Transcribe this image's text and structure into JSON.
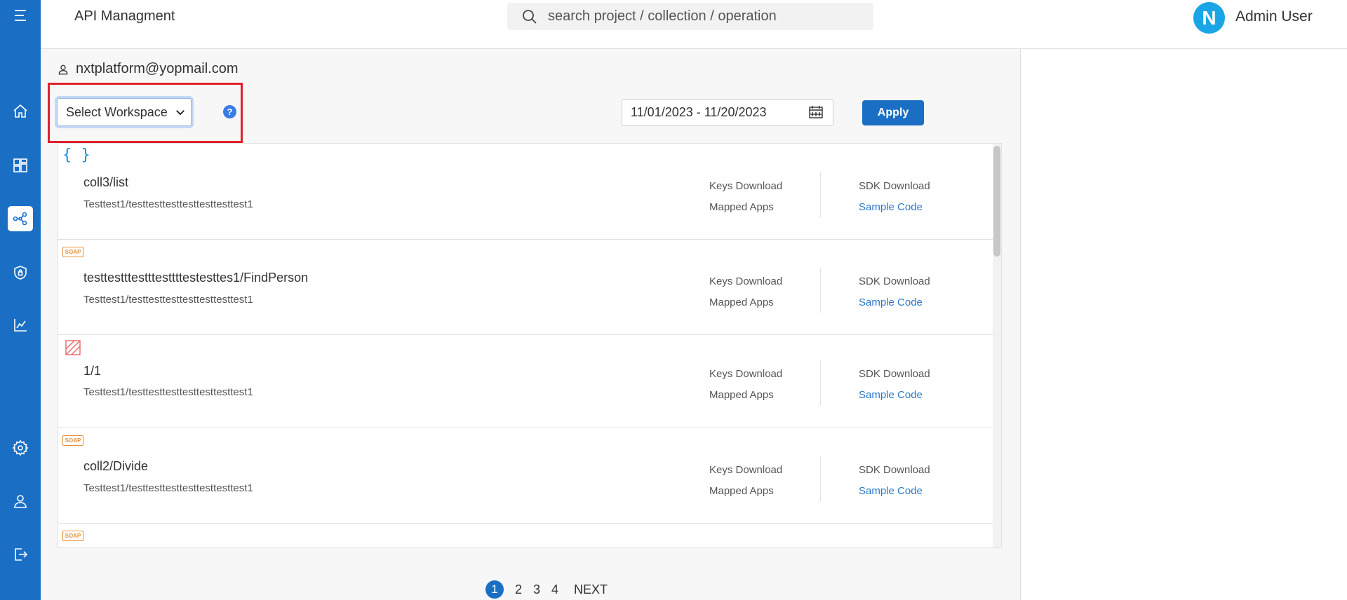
{
  "header": {
    "app_title": "API Managment",
    "search_placeholder": "search project / collection / operation",
    "avatar_letter": "N",
    "user_name": "Admin User"
  },
  "sidebar": {
    "items": [
      {
        "icon": "menu-icon"
      },
      {
        "icon": "home-icon"
      },
      {
        "icon": "dashboard-icon"
      },
      {
        "icon": "share-network-icon",
        "active": true
      },
      {
        "icon": "shield-lock-icon"
      },
      {
        "icon": "analytics-chart-icon"
      },
      {
        "icon": "gear-icon"
      },
      {
        "icon": "user-icon"
      },
      {
        "icon": "logout-icon"
      }
    ]
  },
  "main": {
    "email": "nxtplatform@yopmail.com",
    "workspace_select": "Select Workspace",
    "help_label": "?",
    "date_range": "11/01/2023 - 11/20/2023",
    "apply_label": "Apply"
  },
  "operations": [
    {
      "type": "rest",
      "name": "coll3/list",
      "path": "Testtest1/testtesttesttesttesttesttest1",
      "keys_download": "Keys Download",
      "mapped_apps": "Mapped Apps",
      "sdk_download": "SDK Download",
      "sample_code": "Sample Code"
    },
    {
      "type": "soap",
      "badge": "SOAP",
      "name": "testtestttestttesttttestesttes1/FindPerson",
      "path": "Testtest1/testtesttesttesttesttesttest1",
      "keys_download": "Keys Download",
      "mapped_apps": "Mapped Apps",
      "sdk_download": "SDK Download",
      "sample_code": "Sample Code"
    },
    {
      "type": "broken",
      "name": "1/1",
      "path": "Testtest1/testtesttesttesttesttesttest1",
      "keys_download": "Keys Download",
      "mapped_apps": "Mapped Apps",
      "sdk_download": "SDK Download",
      "sample_code": "Sample Code"
    },
    {
      "type": "soap",
      "badge": "SOAP",
      "name": "coll2/Divide",
      "path": "Testtest1/testtesttesttesttesttesttest1",
      "keys_download": "Keys Download",
      "mapped_apps": "Mapped Apps",
      "sdk_download": "SDK Download",
      "sample_code": "Sample Code"
    },
    {
      "type": "soap",
      "badge": "SOAP"
    }
  ],
  "pagination": {
    "pages": [
      "1",
      "2",
      "3",
      "4"
    ],
    "current": "1",
    "next_label": "NEXT"
  },
  "colors": {
    "sidebar_bg": "#1a6fc4",
    "accent": "#1a6fc4",
    "link": "#2a78c9",
    "highlight_border": "#e0202c",
    "soap_badge": "#e7913a"
  }
}
